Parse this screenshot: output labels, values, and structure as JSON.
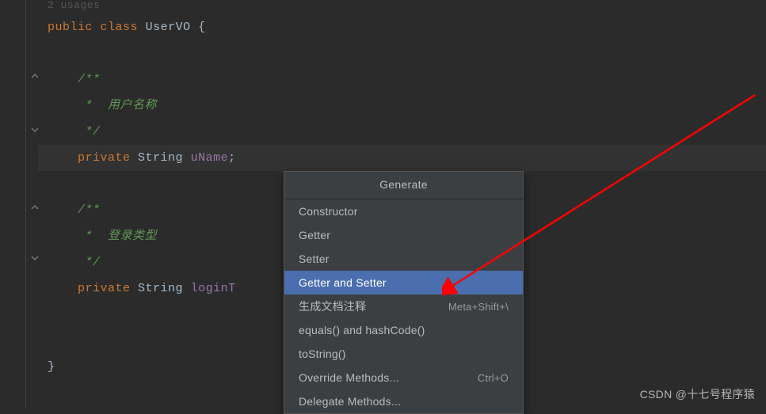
{
  "code": {
    "usages_hint": "2 usages",
    "kw_public": "public",
    "kw_class": "class",
    "kw_private": "private",
    "classname": "UserVO",
    "brace_open": "{",
    "brace_close": "}",
    "type_string": "String",
    "field1": "uName",
    "field2": "loginT",
    "semicolon": ";",
    "doc_open": "/**",
    "doc_line1": " *  用户名称",
    "doc_line2": " *  登录类型",
    "doc_close": " */"
  },
  "popup": {
    "title": "Generate",
    "items": [
      {
        "label": "Constructor",
        "shortcut": ""
      },
      {
        "label": "Getter",
        "shortcut": ""
      },
      {
        "label": "Setter",
        "shortcut": ""
      },
      {
        "label": "Getter and Setter",
        "shortcut": ""
      },
      {
        "label": "生成文档注释",
        "shortcut": "Meta+Shift+\\"
      },
      {
        "label": "equals() and hashCode()",
        "shortcut": ""
      },
      {
        "label": "toString()",
        "shortcut": ""
      },
      {
        "label": "Override Methods...",
        "shortcut": "Ctrl+O"
      },
      {
        "label": "Delegate Methods...",
        "shortcut": ""
      }
    ],
    "selected_index": 3
  },
  "watermark": "CSDN @十七号程序猿"
}
